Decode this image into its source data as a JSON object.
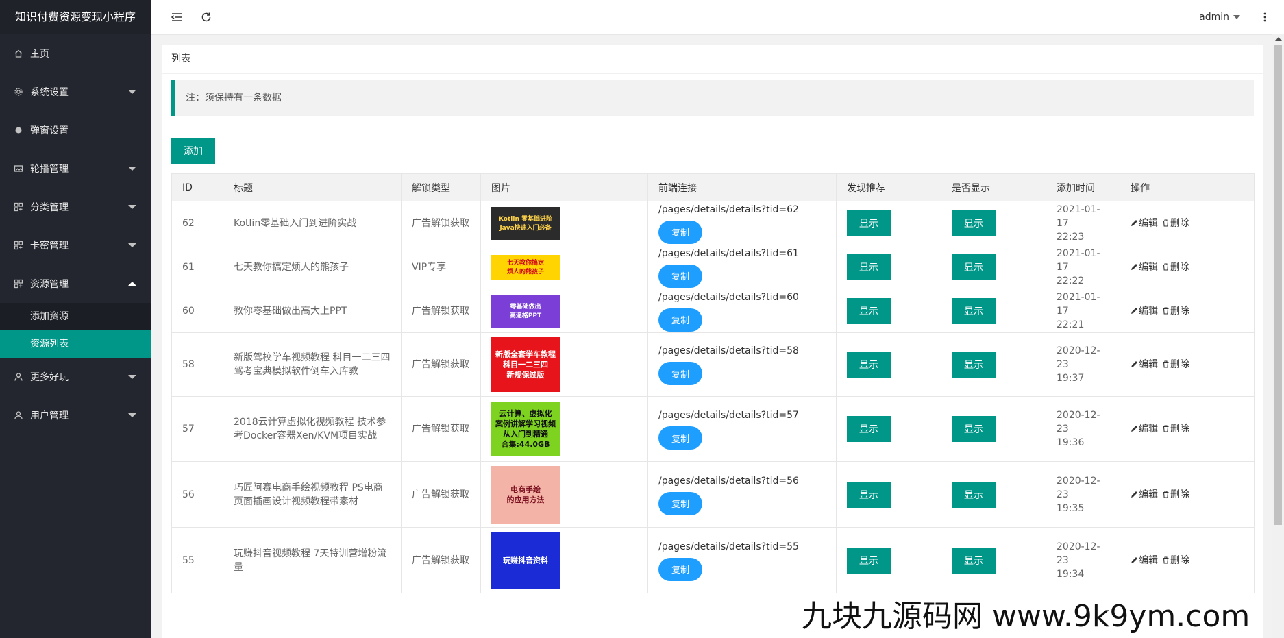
{
  "app": {
    "title": "知识付费资源变现小程序"
  },
  "sidebar": {
    "items": [
      {
        "label": "主页",
        "icon": "home-icon",
        "has_arrow": false
      },
      {
        "label": "系统设置",
        "icon": "gear-icon",
        "has_arrow": true
      },
      {
        "label": "弹窗设置",
        "icon": "dot-icon",
        "has_arrow": false
      },
      {
        "label": "轮播管理",
        "icon": "image-icon",
        "has_arrow": true
      },
      {
        "label": "分类管理",
        "icon": "apps-icon",
        "has_arrow": true
      },
      {
        "label": "卡密管理",
        "icon": "apps-icon",
        "has_arrow": true
      },
      {
        "label": "资源管理",
        "icon": "apps-icon",
        "has_arrow": true,
        "expanded": true,
        "children": [
          {
            "label": "添加资源"
          },
          {
            "label": "资源列表",
            "active": true
          }
        ]
      },
      {
        "label": "更多好玩",
        "icon": "user-icon",
        "has_arrow": true
      },
      {
        "label": "用户管理",
        "icon": "user-icon",
        "has_arrow": true
      }
    ]
  },
  "header": {
    "user": "admin"
  },
  "main": {
    "card_title": "列表",
    "note": "注：须保持有一条数据",
    "add_label": "添加",
    "columns": [
      "ID",
      "标题",
      "解锁类型",
      "图片",
      "前端连接",
      "发现推荐",
      "是否显示",
      "添加时间",
      "操作"
    ],
    "rows": [
      {
        "id": "62",
        "title": "Kotlin零基础入门到进阶实战",
        "unlock": "广告解锁获取",
        "img_text": "Kotlin 零基础进阶\nJava快速入门必备",
        "img_bg": "#2b2b2b",
        "img_fg": "#ffd34a",
        "img_h": 48,
        "link": "/pages/details/details?tid=62",
        "copy": "复制",
        "discover": "显示",
        "display": "显示",
        "date": "2021-01-17",
        "time": "22:23",
        "edit": "编辑",
        "del": "删除"
      },
      {
        "id": "61",
        "title": "七天教你搞定烦人的熊孩子",
        "unlock": "VIP专享",
        "img_text": "七天教你搞定\n烦人的熊孩子",
        "img_bg": "#ffd400",
        "img_fg": "#d0021b",
        "img_h": 36,
        "link": "/pages/details/details?tid=61",
        "copy": "复制",
        "discover": "显示",
        "display": "显示",
        "date": "2021-01-17",
        "time": "22:22",
        "edit": "编辑",
        "del": "删除"
      },
      {
        "id": "60",
        "title": "教你零基础做出高大上PPT",
        "unlock": "广告解锁获取",
        "img_text": "零基础做出\n高逼格PPT",
        "img_bg": "#7b3fd8",
        "img_fg": "#ffffff",
        "img_h": 48,
        "link": "/pages/details/details?tid=60",
        "copy": "复制",
        "discover": "显示",
        "display": "显示",
        "date": "2021-01-17",
        "time": "22:21",
        "edit": "编辑",
        "del": "删除"
      },
      {
        "id": "58",
        "title": "新版驾校学车视频教程 科目一二三四 驾考宝典模拟软件倒车入库教",
        "unlock": "广告解锁获取",
        "img_text": "新版全套学车教程\n科目一二三四\n新规保过版",
        "img_bg": "#e8141b",
        "img_fg": "#ffffff",
        "img_h": 80,
        "link": "/pages/details/details?tid=58",
        "copy": "复制",
        "discover": "显示",
        "display": "显示",
        "date": "2020-12-23",
        "time": "19:37",
        "edit": "编辑",
        "del": "删除"
      },
      {
        "id": "57",
        "title": "2018云计算虚拟化视频教程 技术参考Docker容器Xen/KVM项目实战",
        "unlock": "广告解锁获取",
        "img_text": "云计算、虚拟化\n案例讲解学习视频\n从入门到精通\n合集:44.0GB",
        "img_bg": "#7ed321",
        "img_fg": "#111111",
        "img_h": 80,
        "link": "/pages/details/details?tid=57",
        "copy": "复制",
        "discover": "显示",
        "display": "显示",
        "date": "2020-12-23",
        "time": "19:36",
        "edit": "编辑",
        "del": "删除"
      },
      {
        "id": "56",
        "title": "巧匠阿赛电商手绘视频教程 PS电商页面插画设计视频教程带素材",
        "unlock": "广告解锁获取",
        "img_text": "电商手绘\n的应用方法",
        "img_bg": "#f3b3a6",
        "img_fg": "#7a1020",
        "img_h": 84,
        "link": "/pages/details/details?tid=56",
        "copy": "复制",
        "discover": "显示",
        "display": "显示",
        "date": "2020-12-23",
        "time": "19:35",
        "edit": "编辑",
        "del": "删除"
      },
      {
        "id": "55",
        "title": "玩赚抖音视频教程 7天特训营增粉流量",
        "unlock": "广告解锁获取",
        "img_text": "玩赚抖音资料",
        "img_bg": "#1b2bd6",
        "img_fg": "#ffffff",
        "img_h": 84,
        "link": "/pages/details/details?tid=55",
        "copy": "复制",
        "discover": "显示",
        "display": "显示",
        "date": "2020-12-23",
        "time": "19:34",
        "edit": "编辑",
        "del": "删除"
      }
    ]
  },
  "watermark": "九块九源码网 www.9k9ym.com"
}
